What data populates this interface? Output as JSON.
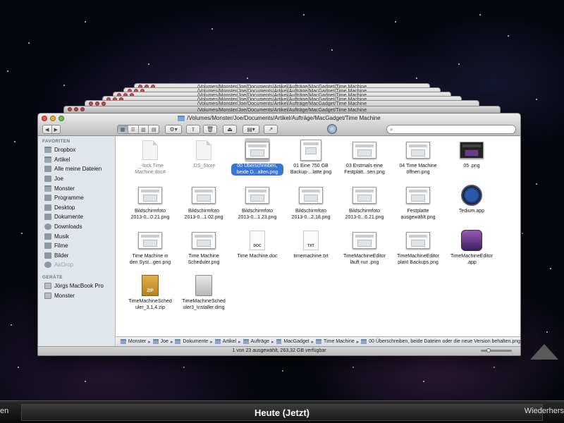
{
  "window": {
    "path_title": "/Volumes/Monster/Joe/Documents/Artikel/Aufträge/MacGadget/Time Machine"
  },
  "toolbar": {
    "search_placeholder": "",
    "nav_back": "◀",
    "nav_forward": "▶"
  },
  "sidebar": {
    "favorites_header": "FAVORITEN",
    "favorites": [
      {
        "label": "Dropbox",
        "icon": "folder-icon"
      },
      {
        "label": "Artikel",
        "icon": "folder-icon"
      },
      {
        "label": "Alle meine Dateien",
        "icon": "all-files-icon"
      },
      {
        "label": "Joe",
        "icon": "home-icon"
      },
      {
        "label": "Monster",
        "icon": "folder-icon"
      },
      {
        "label": "Programme",
        "icon": "applications-icon"
      },
      {
        "label": "Desktop",
        "icon": "desktop-icon"
      },
      {
        "label": "Dokumente",
        "icon": "documents-icon"
      },
      {
        "label": "Downloads",
        "icon": "downloads-icon"
      },
      {
        "label": "Musik",
        "icon": "music-icon"
      },
      {
        "label": "Filme",
        "icon": "movies-icon"
      },
      {
        "label": "Bilder",
        "icon": "pictures-icon"
      },
      {
        "label": "AirDrop",
        "icon": "airdrop-icon"
      }
    ],
    "devices_header": "GERÄTE",
    "devices": [
      {
        "label": "Jörgs MacBook Pro",
        "icon": "laptop-icon"
      },
      {
        "label": "Monster",
        "icon": "drive-icon"
      }
    ]
  },
  "files": [
    {
      "name": "._-lock.Time\nMachine.doc#",
      "kind": "blank",
      "dim": true
    },
    {
      "name": ".DS_Store",
      "kind": "blank",
      "dim": true
    },
    {
      "name": "00 Überschreiben,\nbeide D...alten.png",
      "kind": "shot",
      "selected": true
    },
    {
      "name": "01 Eine 750 GB\nBackup-...latte.png",
      "kind": "shot-tall"
    },
    {
      "name": "03 Erstmals eine\nFestplatt...sen.png",
      "kind": "shot"
    },
    {
      "name": "04 Time Machine\nöffnen.png",
      "kind": "shot"
    },
    {
      "name": "05 .png",
      "kind": "shot-dark"
    },
    {
      "name": "Bildschirmfoto\n2013-0...0.21.png",
      "kind": "shot"
    },
    {
      "name": "Bildschirmfoto\n2013-0...1.02.png",
      "kind": "shot"
    },
    {
      "name": "Bildschirmfoto\n2013-0...1.23.png",
      "kind": "shot"
    },
    {
      "name": "Bildschirmfoto\n2013-0...2.18.png",
      "kind": "shot"
    },
    {
      "name": "Bildschirmfoto\n2013-0...6.21.png",
      "kind": "shot"
    },
    {
      "name": "Festplatte\nausgewählt.png",
      "kind": "shot"
    },
    {
      "name": "Tedium.app",
      "kind": "app-clock"
    },
    {
      "name": "Time Machine in\nden Syst...gen.png",
      "kind": "shot"
    },
    {
      "name": "Time Machine\nScheduler.png",
      "kind": "shot"
    },
    {
      "name": "Time Machine.doc",
      "kind": "doc",
      "tag": "DOC"
    },
    {
      "name": "timemachine.txt",
      "kind": "doc",
      "tag": "TXT"
    },
    {
      "name": "TimeMachineEditor\nläuft nur .png",
      "kind": "shot"
    },
    {
      "name": "TimeMachineEditor\nplant Backups.png",
      "kind": "shot"
    },
    {
      "name": "TimeMachineEditor\n.app",
      "kind": "app-tm"
    },
    {
      "name": "TimeMachineSched\nuler_3.1.4.zip",
      "kind": "zip",
      "tag": "ZIP"
    },
    {
      "name": "TimeMachineSched\nuler3_Installer.dmg",
      "kind": "dmg"
    }
  ],
  "pathbar": [
    "Monster",
    "Joe",
    "Dokumente",
    "Artikel",
    "Aufträge",
    "MacGadget",
    "Time Machine",
    "00 Überschreiben, beide Dateien oder die neue Version behalten.png"
  ],
  "status": "1 von 23 ausgewählt, 263,32 GB verfügbar",
  "timebar": {
    "current": "Heute (Jetzt)",
    "left_partial": "en",
    "right_partial": "Wiederhers"
  }
}
